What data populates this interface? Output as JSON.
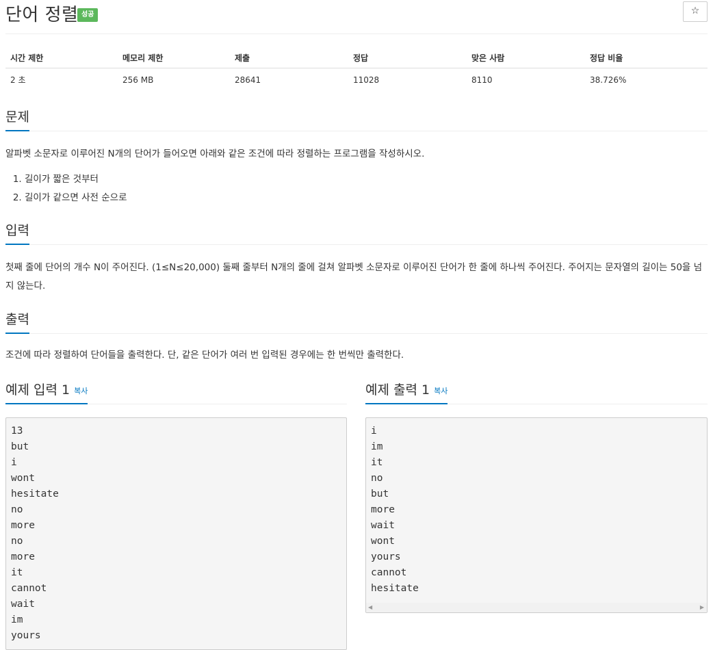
{
  "header": {
    "title": "단어 정렬",
    "badge": "성공",
    "star": "☆"
  },
  "info": {
    "headers": [
      "시간 제한",
      "메모리 제한",
      "제출",
      "정답",
      "맞은 사람",
      "정답 비율"
    ],
    "values": [
      "2 초",
      "256 MB",
      "28641",
      "11028",
      "8110",
      "38.726%"
    ]
  },
  "problem": {
    "heading": "문제",
    "text": "알파벳 소문자로 이루어진 N개의 단어가 들어오면 아래와 같은 조건에 따라 정렬하는 프로그램을 작성하시오.",
    "items": [
      "길이가 짧은 것부터",
      "길이가 같으면 사전 순으로"
    ]
  },
  "input": {
    "heading": "입력",
    "text": "첫째 줄에 단어의 개수 N이 주어진다. (1≤N≤20,000) 둘째 줄부터 N개의 줄에 걸쳐 알파벳 소문자로 이루어진 단어가 한 줄에 하나씩 주어진다. 주어지는 문자열의 길이는 50을 넘지 않는다."
  },
  "output": {
    "heading": "출력",
    "text": "조건에 따라 정렬하여 단어들을 출력한다. 단, 같은 단어가 여러 번 입력된 경우에는 한 번씩만 출력한다."
  },
  "sample_input": {
    "heading": "예제 입력 1",
    "copy": "복사",
    "content": "13\nbut\ni\nwont\nhesitate\nno\nmore\nno\nmore\nit\ncannot\nwait\nim\nyours"
  },
  "sample_output": {
    "heading": "예제 출력 1",
    "copy": "복사",
    "content": "i\nim\nit\nno\nbut\nmore\nwait\nwont\nyours\ncannot\nhesitate"
  },
  "scroll_arrows": {
    "left": "◀",
    "right": "▶"
  }
}
